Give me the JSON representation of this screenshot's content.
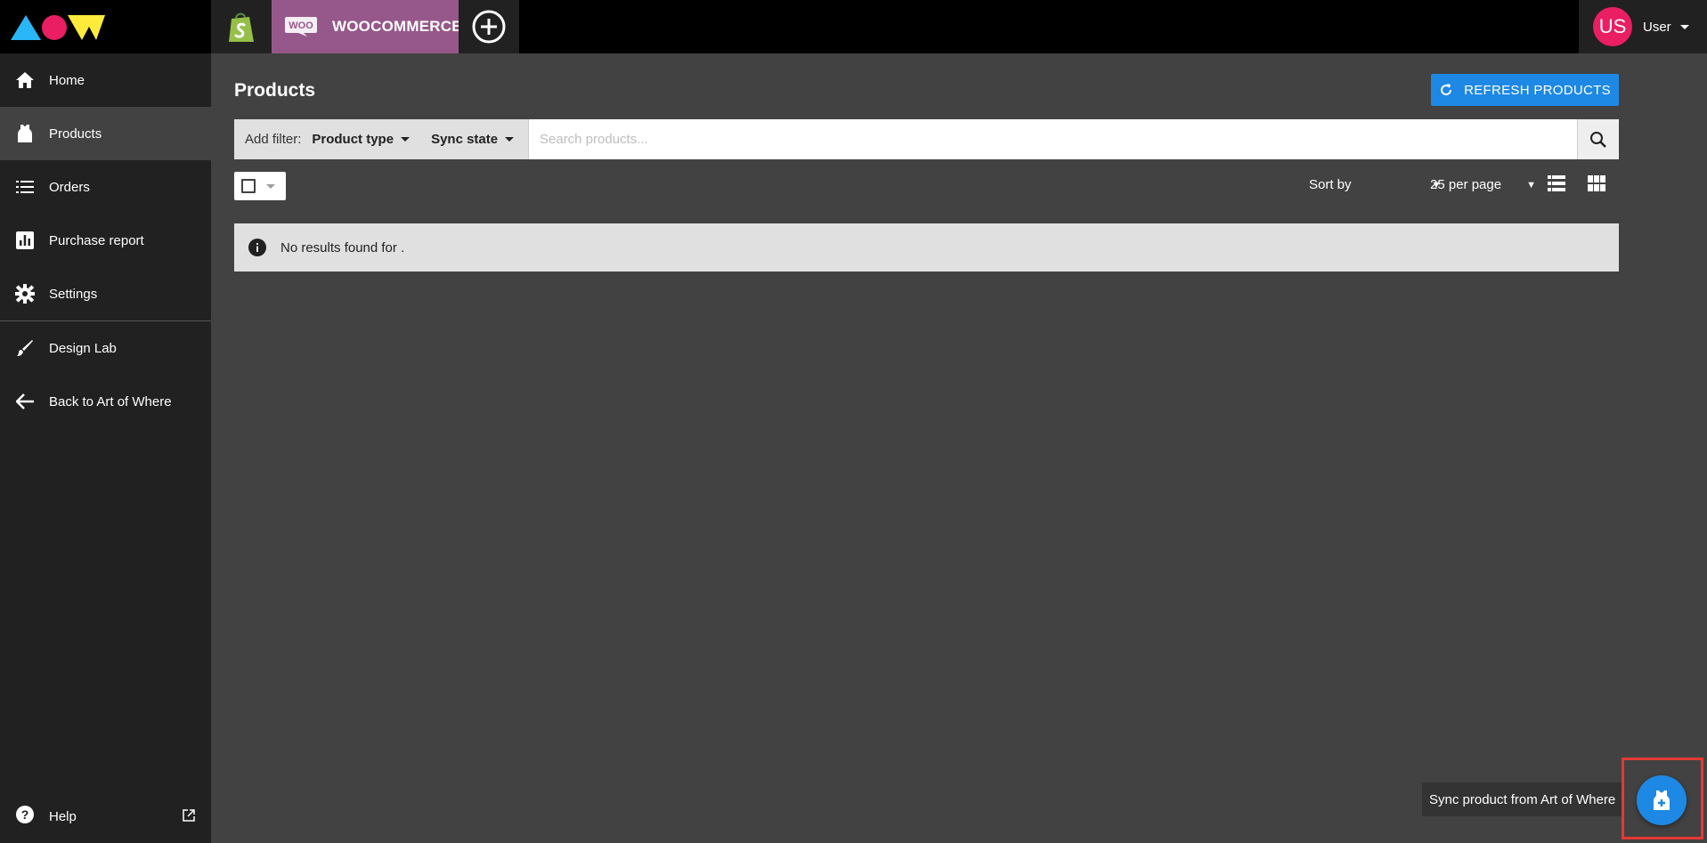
{
  "topbar": {
    "stores": [
      {
        "name": "shopify",
        "icon": "shopify-bag-icon"
      },
      {
        "name": "woocommerce",
        "badge": "WOO",
        "label": "WOOCOMMERCE",
        "icon": "woo-badge-icon"
      },
      {
        "name": "add-store",
        "icon": "plus-circle-icon"
      }
    ],
    "user": {
      "initials": "US",
      "name": "User"
    }
  },
  "sidebar": {
    "items": [
      {
        "label": "Home",
        "icon": "home-icon"
      },
      {
        "label": "Products",
        "icon": "tank-top-icon",
        "active": true
      },
      {
        "label": "Orders",
        "icon": "list-icon"
      },
      {
        "label": "Purchase report",
        "icon": "bar-chart-icon"
      },
      {
        "label": "Settings",
        "icon": "gear-icon"
      },
      {
        "label": "Design Lab",
        "icon": "brush-icon"
      },
      {
        "label": "Back to Art of Where",
        "icon": "arrow-left-icon"
      }
    ],
    "help": {
      "label": "Help",
      "icon": "help-icon"
    }
  },
  "main": {
    "title": "Products",
    "refresh_label": "REFRESH PRODUCTS",
    "filter": {
      "add_label": "Add filter:",
      "product_type": "Product type",
      "sync_state": "Sync state"
    },
    "search": {
      "placeholder": "Search products...",
      "value": ""
    },
    "sort_label": "Sort by",
    "per_page_label": "25 per page",
    "alert_text": "No results found for ."
  },
  "fab": {
    "tooltip": "Sync product from Art of Where",
    "icon": "sync-product-icon"
  },
  "colors": {
    "accent": "#1e88e5",
    "woo": "#96588a",
    "avatar": "#e91e63",
    "highlight": "#e53935"
  }
}
